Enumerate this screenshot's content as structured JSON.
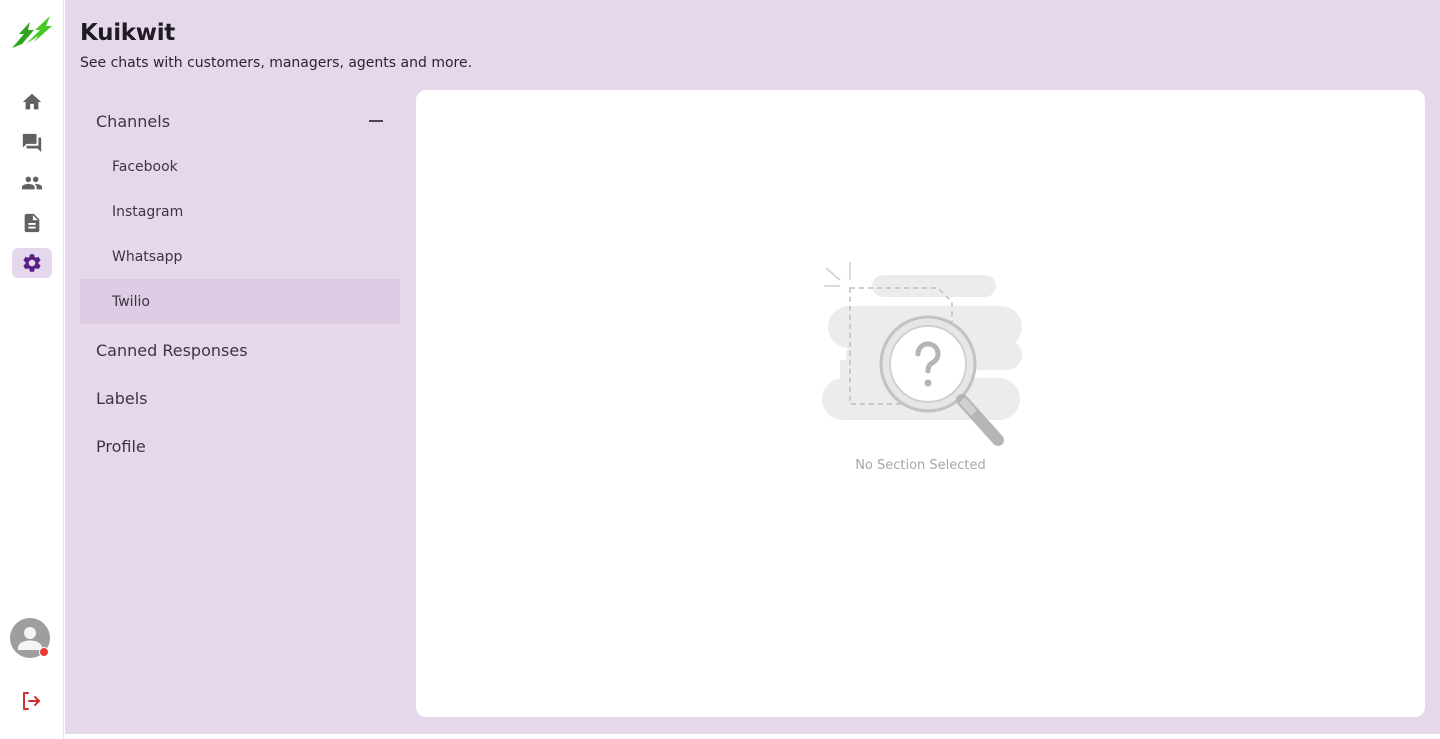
{
  "app": {
    "title": "Kuikwit",
    "subtitle": "See chats with customers, managers, agents and more."
  },
  "rail": {
    "items": [
      {
        "name": "home-icon"
      },
      {
        "name": "chat-icon"
      },
      {
        "name": "people-icon"
      },
      {
        "name": "document-icon"
      },
      {
        "name": "settings-icon",
        "active": true
      }
    ],
    "logout_icon": "logout-icon",
    "status_color": "#e53935"
  },
  "menu": {
    "channels_label": "Channels",
    "channels": [
      {
        "label": "Facebook"
      },
      {
        "label": "Instagram"
      },
      {
        "label": "Whatsapp"
      },
      {
        "label": "Twilio",
        "selected": true
      }
    ],
    "links": [
      {
        "label": "Canned Responses"
      },
      {
        "label": "Labels"
      },
      {
        "label": "Profile"
      }
    ]
  },
  "panel": {
    "empty_text": "No Section Selected"
  },
  "colors": {
    "accent": "#5b1f84",
    "background": "#e6d8eb",
    "logo_green": "#3cc11e"
  }
}
